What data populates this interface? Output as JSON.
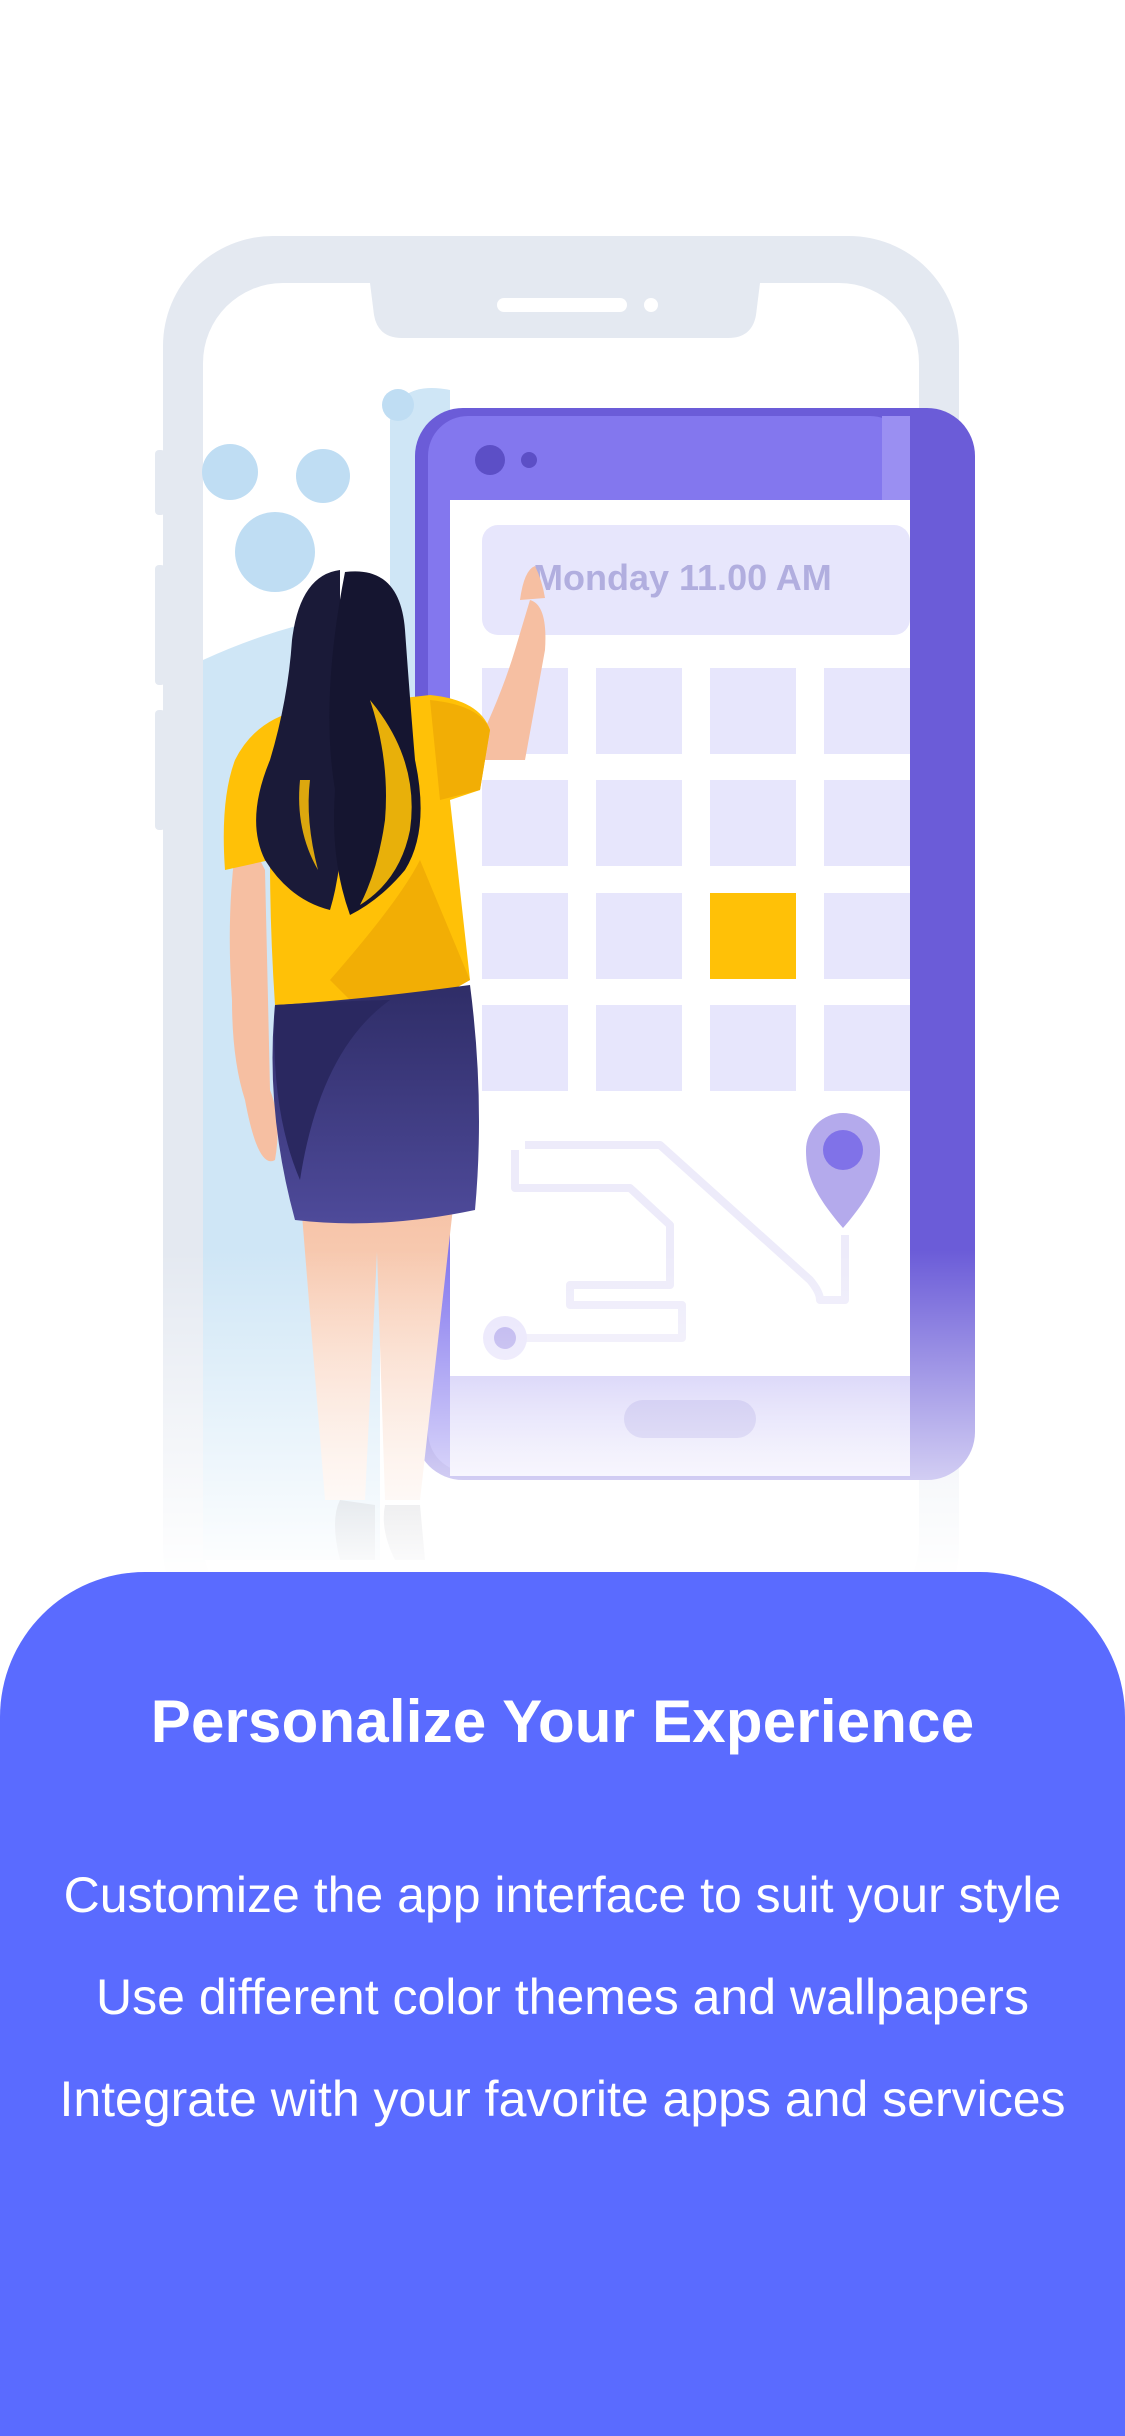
{
  "illustration": {
    "calendar_time_label": "Monday 11.00 AM",
    "highlight_color": "#FFC107",
    "accent_color": "#8377EE"
  },
  "onboarding": {
    "title": "Personalize Your Experience",
    "features": [
      "Customize the app interface to suit your style",
      "Use different color themes and wallpapers",
      "Integrate with your favorite apps and services"
    ]
  },
  "theme": {
    "panel_color": "#5A6BFF",
    "text_color": "#FFFFFF"
  }
}
